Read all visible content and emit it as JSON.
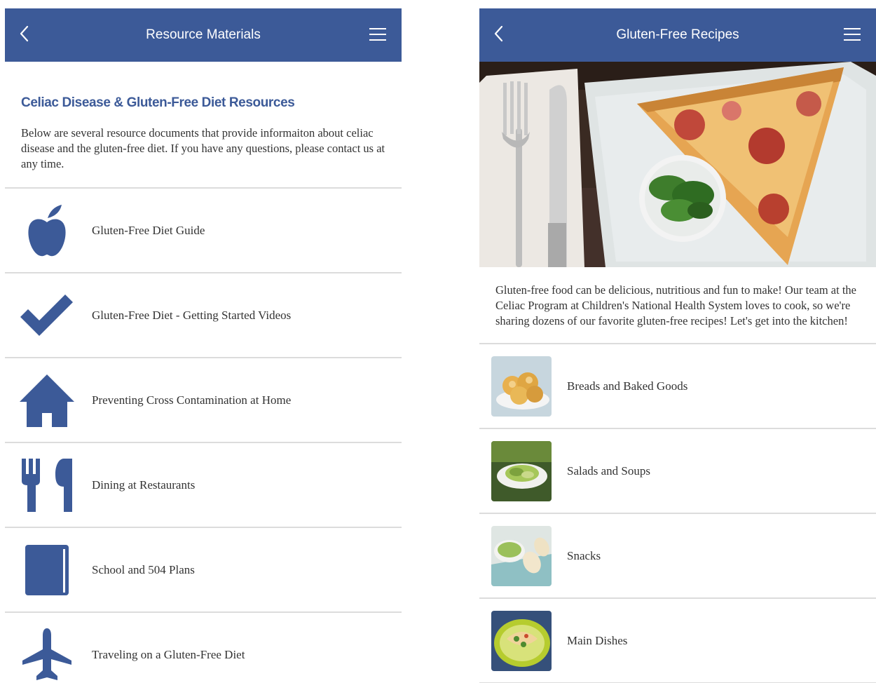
{
  "colors": {
    "brand": "#3c5a98",
    "divider": "#dcdcdc",
    "text": "#333333"
  },
  "left": {
    "nav": {
      "title": "Resource Materials",
      "back_icon": "chevron-left-icon",
      "menu_icon": "hamburger-menu-icon"
    },
    "heading": "Celiac Disease & Gluten-Free Diet Resources",
    "intro": "Below are several resource documents that provide informaiton about celiac disease and the gluten-free diet. If you have any questions, please contact us at any time.",
    "items": [
      {
        "label": "Gluten-Free Diet Guide",
        "icon": "apple-icon"
      },
      {
        "label": "Gluten-Free Diet - Getting Started Videos",
        "icon": "checkmark-icon"
      },
      {
        "label": "Preventing Cross Contamination at Home",
        "icon": "house-icon"
      },
      {
        "label": "Dining at Restaurants",
        "icon": "fork-knife-icon"
      },
      {
        "label": "School and 504 Plans",
        "icon": "book-icon"
      },
      {
        "label": "Traveling on a Gluten-Free Diet",
        "icon": "airplane-icon"
      }
    ]
  },
  "right": {
    "nav": {
      "title": "Gluten-Free Recipes",
      "back_icon": "chevron-left-icon",
      "menu_icon": "hamburger-menu-icon"
    },
    "intro": "Gluten-free food can be delicious, nutritious and fun to make! Our team at the Celiac Program at Children's National Health System loves to cook, so we're sharing dozens of our favorite gluten-free recipes! Let's get into the kitchen!",
    "items": [
      {
        "label": "Breads and Baked Goods"
      },
      {
        "label": "Salads and Soups"
      },
      {
        "label": "Snacks"
      },
      {
        "label": "Main Dishes"
      }
    ]
  }
}
